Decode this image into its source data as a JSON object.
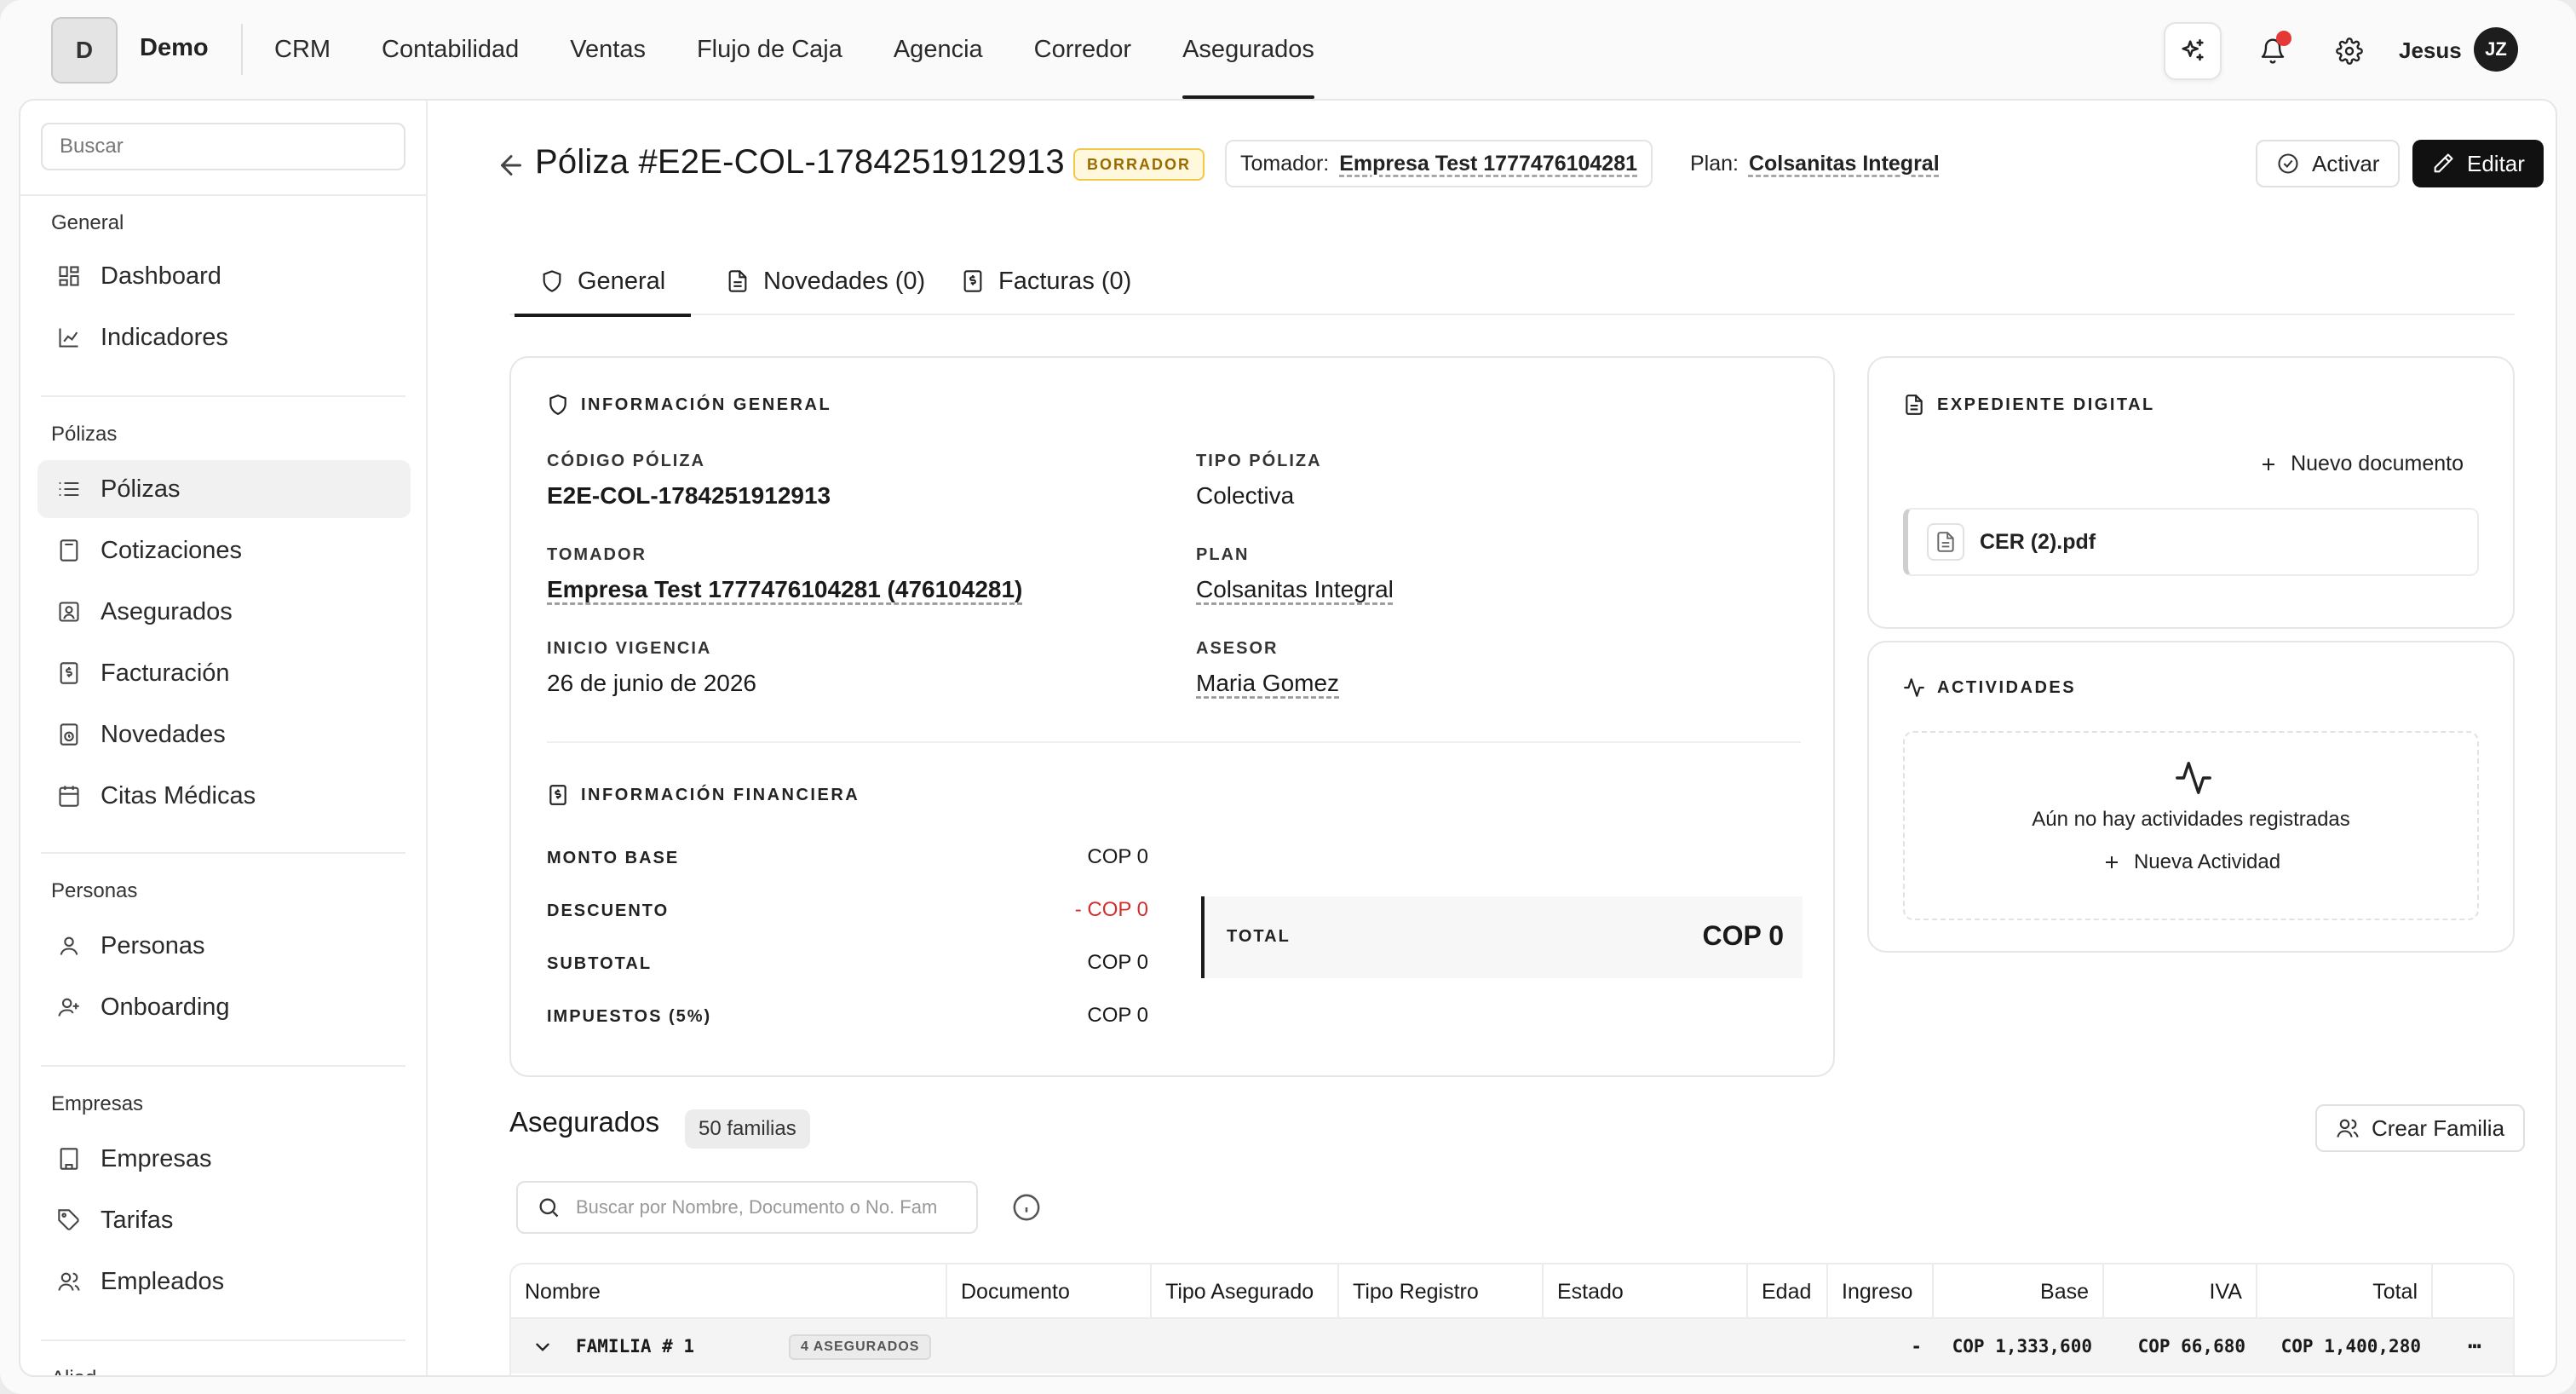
{
  "brand": {
    "initial": "D",
    "name": "Demo"
  },
  "nav": [
    {
      "label": "CRM",
      "active": false
    },
    {
      "label": "Contabilidad",
      "active": false
    },
    {
      "label": "Ventas",
      "active": false
    },
    {
      "label": "Flujo de Caja",
      "active": false
    },
    {
      "label": "Agencia",
      "active": false
    },
    {
      "label": "Corredor",
      "active": false
    },
    {
      "label": "Asegurados",
      "active": true
    }
  ],
  "user": {
    "name": "Jesus",
    "initials": "JZ"
  },
  "sidebar": {
    "search_placeholder": "Buscar",
    "groups": [
      {
        "title": "General",
        "items": [
          {
            "label": "Dashboard",
            "icon": "dashboard-icon"
          },
          {
            "label": "Indicadores",
            "icon": "chart-icon"
          }
        ]
      },
      {
        "title": "Pólizas",
        "items": [
          {
            "label": "Pólizas",
            "icon": "list-icon",
            "active": true
          },
          {
            "label": "Cotizaciones",
            "icon": "calculator-icon"
          },
          {
            "label": "Asegurados",
            "icon": "id-card-icon"
          },
          {
            "label": "Facturación",
            "icon": "receipt-icon"
          },
          {
            "label": "Novedades",
            "icon": "novedades-icon"
          },
          {
            "label": "Citas Médicas",
            "icon": "calendar-icon"
          }
        ]
      },
      {
        "title": "Personas",
        "items": [
          {
            "label": "Personas",
            "icon": "user-icon"
          },
          {
            "label": "Onboarding",
            "icon": "user-plus-icon"
          }
        ]
      },
      {
        "title": "Empresas",
        "items": [
          {
            "label": "Empresas",
            "icon": "building-icon"
          },
          {
            "label": "Tarifas",
            "icon": "tag-icon"
          },
          {
            "label": "Empleados",
            "icon": "users-icon"
          }
        ]
      }
    ],
    "cut_group": "Aliad"
  },
  "header": {
    "title": "Póliza #E2E-COL-1784251912913",
    "status": "BORRADOR",
    "tomador_label": "Tomador:",
    "tomador_value": "Empresa Test 1777476104281",
    "plan_label": "Plan:",
    "plan_value": "Colsanitas Integral",
    "activate_label": "Activar",
    "edit_label": "Editar"
  },
  "tabs": [
    {
      "label": "General",
      "active": true
    },
    {
      "label": "Novedades (0)",
      "active": false
    },
    {
      "label": "Facturas (0)",
      "active": false
    }
  ],
  "general_info": {
    "section_title": "INFORMACIÓN GENERAL",
    "codigo_label": "CÓDIGO PÓLIZA",
    "codigo_value": "E2E-COL-1784251912913",
    "tipo_label": "TIPO PÓLIZA",
    "tipo_value": "Colectiva",
    "tomador_label": "TOMADOR",
    "tomador_value": "Empresa Test 1777476104281 (476104281)",
    "plan_label": "PLAN",
    "plan_value": "Colsanitas Integral",
    "inicio_label": "INICIO VIGENCIA",
    "inicio_value": "26 de junio de 2026",
    "asesor_label": "ASESOR",
    "asesor_value": "Maria Gomez"
  },
  "financial": {
    "section_title": "INFORMACIÓN FINANCIERA",
    "rows": [
      {
        "label": "MONTO BASE",
        "value": "COP 0"
      },
      {
        "label": "DESCUENTO",
        "value": "- COP 0"
      },
      {
        "label": "SUBTOTAL",
        "value": "COP 0"
      },
      {
        "label": "IMPUESTOS (5%)",
        "value": "COP 0"
      }
    ],
    "total_label": "TOTAL",
    "total_value": "COP 0"
  },
  "expediente": {
    "title": "EXPEDIENTE DIGITAL",
    "new_doc_label": "Nuevo documento",
    "documents": [
      "CER (2).pdf"
    ]
  },
  "actividades": {
    "title": "ACTIVIDADES",
    "empty_text": "Aún no hay actividades registradas",
    "new_label": "Nueva Actividad"
  },
  "asegurados": {
    "title": "Asegurados",
    "count": "50 familias",
    "create_label": "Crear Familia",
    "search_placeholder": "Buscar por Nombre, Documento o No. Fam",
    "columns": [
      "Nombre",
      "Documento",
      "Tipo Asegurado",
      "Tipo Registro",
      "Estado",
      "Edad",
      "Ingreso",
      "Base",
      "IVA",
      "Total"
    ],
    "rows": [
      {
        "family": "FAMILIA # 1",
        "badge": "4 ASEGURADOS",
        "ingreso": "-",
        "base": "COP 1,333,600",
        "iva": "COP 66,680",
        "total": "COP 1,400,280",
        "more": "⋯"
      }
    ]
  }
}
